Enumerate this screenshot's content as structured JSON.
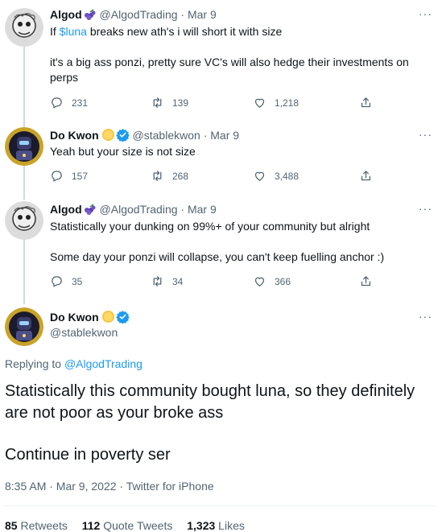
{
  "tweets": [
    {
      "name": "Algod",
      "handle": "@AlgodTrading",
      "date": "Mar 9",
      "text_prefix": "If ",
      "text_link": "$luna",
      "text_suffix": " breaks new ath's i will short it with size",
      "text2": "it's a big ass ponzi, pretty sure VC's will also hedge their investments on perps",
      "replies": "231",
      "retweets": "139",
      "likes": "1,218"
    },
    {
      "name": "Do Kwon",
      "handle": "@stablekwon",
      "date": "Mar 9",
      "text": "Yeah but your size is not size",
      "replies": "157",
      "retweets": "268",
      "likes": "3,488"
    },
    {
      "name": "Algod",
      "handle": "@AlgodTrading",
      "date": "Mar 9",
      "text": "Statistically your dunking on 99%+ of your community but alright",
      "text2": "Some day your ponzi will collapse, you can't keep fuelling anchor :)",
      "replies": "35",
      "retweets": "34",
      "likes": "366"
    }
  ],
  "main": {
    "name": "Do Kwon",
    "handle": "@stablekwon",
    "replying_prefix": "Replying to ",
    "replying_to": "@AlgodTrading",
    "text": "Statistically this community bought luna, so they definitely are not poor as your broke ass",
    "text2": "Continue in poverty ser",
    "timestamp": "8:35 AM · Mar 9, 2022 · Twitter for iPhone",
    "retweets_count": "85",
    "retweets_label": "Retweets",
    "quotes_count": "112",
    "quotes_label": "Quote Tweets",
    "likes_count": "1,323",
    "likes_label": "Likes"
  },
  "ui": {
    "separator": " · ",
    "more": "···"
  },
  "colors": {
    "link": "#1d9bf0",
    "secondary": "#536471",
    "verified": "#1d9bf0"
  },
  "icons": [
    "reply-icon",
    "retweet-icon",
    "like-icon",
    "share-icon",
    "verified-icon",
    "grape-icon",
    "sun-icon",
    "more-icon"
  ]
}
